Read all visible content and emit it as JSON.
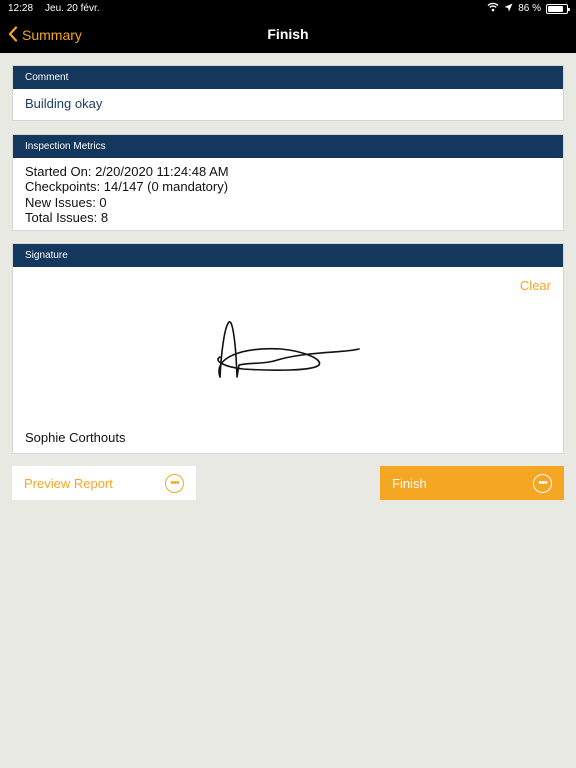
{
  "status": {
    "time": "12:28",
    "date": "Jeu. 20 févr.",
    "battery": "86 %",
    "battery_level": 0.86
  },
  "nav": {
    "back_label": "Summary",
    "title": "Finish"
  },
  "comment": {
    "header": "Comment",
    "text": "Building okay"
  },
  "metrics": {
    "header": "Inspection Metrics",
    "lines": [
      "Started On: 2/20/2020 11:24:48 AM",
      "Checkpoints: 14/147 (0 mandatory)",
      "New Issues: 0",
      "Total Issues: 8"
    ]
  },
  "signature": {
    "header": "Signature",
    "clear_label": "Clear",
    "signer": "Sophie Corthouts"
  },
  "buttons": {
    "preview_label": "Preview Report",
    "finish_label": "Finish"
  },
  "colors": {
    "accent": "#f5a623",
    "header_bg": "#14375e",
    "background": "#e9e9e4"
  }
}
